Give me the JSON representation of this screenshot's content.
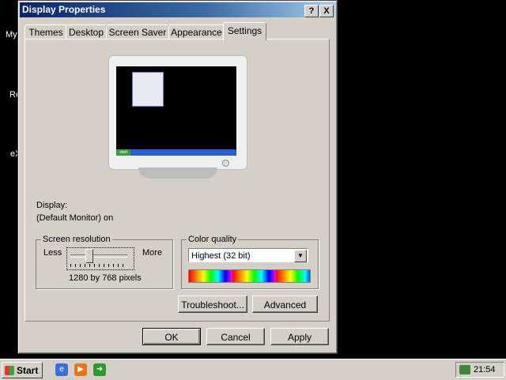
{
  "desktop": {
    "labels": [
      "My",
      "Re",
      "eX"
    ]
  },
  "window": {
    "title": "Display Properties",
    "help_btn": "?",
    "close_btn": "X"
  },
  "tabs": [
    "Themes",
    "Desktop",
    "Screen Saver",
    "Appearance",
    "Settings"
  ],
  "active_tab": "Settings",
  "mini_taskbar_start": "start",
  "display": {
    "label": "Display:",
    "value": "(Default Monitor) on"
  },
  "resolution": {
    "title": "Screen resolution",
    "less": "Less",
    "more": "More",
    "value_text": "1280 by 768 pixels",
    "slider_fraction": 0.33
  },
  "color_quality": {
    "title": "Color quality",
    "selected": "Highest (32 bit)"
  },
  "buttons": {
    "troubleshoot": "Troubleshoot...",
    "advanced": "Advanced",
    "ok": "OK",
    "cancel": "Cancel",
    "apply": "Apply"
  },
  "taskbar": {
    "start_label": "Start",
    "clock": "21:54"
  },
  "colors": {
    "title_start": "#0a246a",
    "title_end": "#a6caf0",
    "face": "#d4d0c8",
    "taskbar_blue": "#245edb"
  },
  "icons": [
    "windows-logo-icon",
    "internet-explorer-icon",
    "media-icon",
    "show-desktop-icon",
    "network-tray-icon"
  ]
}
